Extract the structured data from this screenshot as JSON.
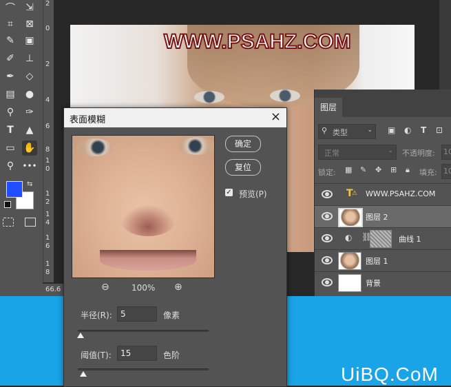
{
  "canvas": {
    "watermark_text": "WWW.PSAHZ.COM",
    "zoom_status": "66.6"
  },
  "ruler": {
    "numbers": [
      "2",
      "0",
      "2",
      "4",
      "6",
      "8",
      "1",
      "0",
      "1",
      "2",
      "1",
      "4",
      "1",
      "6",
      "1",
      "8"
    ]
  },
  "toolbar": {
    "tools": [
      "lasso-icon",
      "move-select-icon",
      "crop-icon",
      "frame-icon",
      "eyedropper-icon",
      "patch-icon",
      "brush-icon",
      "stamp-icon",
      "history-brush-icon",
      "eraser-icon",
      "gradient-icon",
      "blur-icon",
      "dodge-icon",
      "pen-icon",
      "type-icon",
      "path-select-icon",
      "rectangle-icon",
      "hand-icon",
      "zoom-icon",
      "more-icon"
    ],
    "foreground_color": "#1e4eff",
    "background_color": "#ffffff"
  },
  "layers_panel": {
    "tab_label": "图层",
    "filter_placeholder": "类型",
    "blend_mode": "正常",
    "opacity_label": "不透明度:",
    "opacity_value": "10",
    "lock_label": "锁定:",
    "fill_label": "填充:",
    "fill_value": "10",
    "layers": [
      {
        "name": "WWW.PSAHZ.COM",
        "type": "text"
      },
      {
        "name": "图层 2",
        "type": "image",
        "selected": true
      },
      {
        "name": "曲线 1",
        "type": "adjustment"
      },
      {
        "name": "图层 1",
        "type": "image"
      },
      {
        "name": "背景",
        "type": "background"
      }
    ]
  },
  "dialog": {
    "title": "表面模糊",
    "close_label": "×",
    "ok_label": "确定",
    "reset_label": "复位",
    "preview_label": "预览(P)",
    "preview_checked": true,
    "zoom_label": "100%",
    "radius_label": "半径(R):",
    "radius_value": "5",
    "radius_unit": "像素",
    "radius_fraction": 0.02,
    "threshold_label": "阈值(T):",
    "threshold_value": "15",
    "threshold_unit": "色阶",
    "threshold_fraction": 0.04
  },
  "site_watermark": "UiBQ.CoM"
}
